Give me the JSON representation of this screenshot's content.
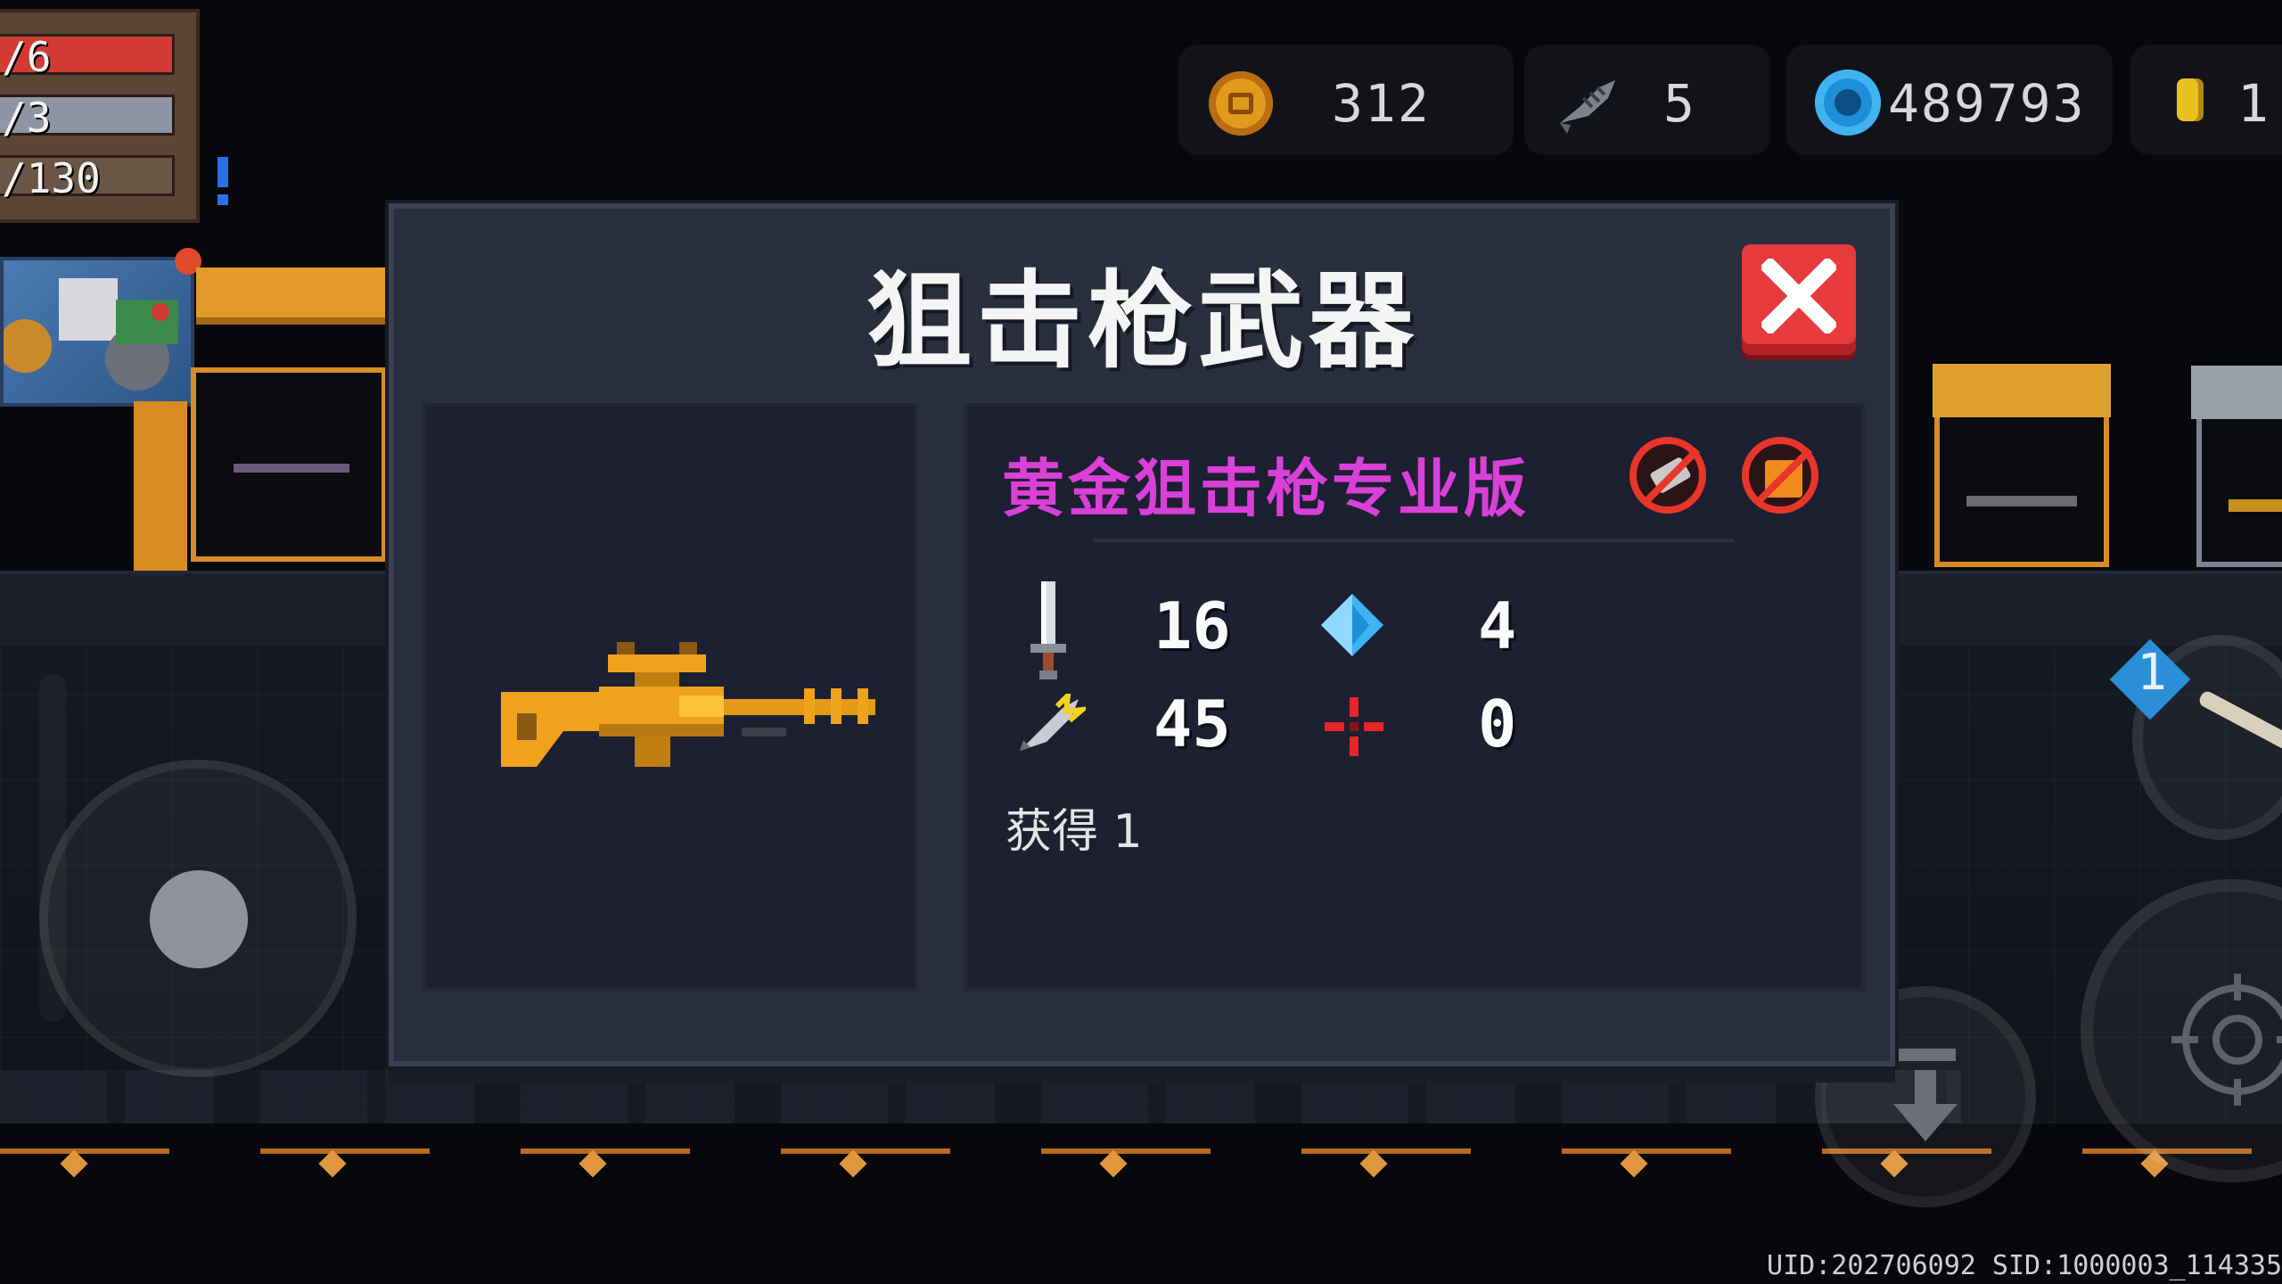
{
  "hud": {
    "hp_text": "/6",
    "armor_text": "/3",
    "energy_text": "/130"
  },
  "currency": {
    "coins": "312",
    "fish": "5",
    "gems": "489793",
    "tokens": "1"
  },
  "modal": {
    "title": "狙击枪武器",
    "weapon_name": "黄金狙击枪专业版",
    "stats": {
      "damage": "16",
      "energy_cost": "4",
      "crit": "45",
      "spread": "0"
    },
    "obtained_label": "获得 1"
  },
  "skill": {
    "badge": "1"
  },
  "footer": {
    "uid": "UID:202706092 SID:1000003_114335"
  },
  "colors": {
    "weapon_name": "#d940d8",
    "close_button": "#e63a3c",
    "gold": "#e0a030",
    "hp": "#d23a34"
  },
  "icons": {
    "currency": [
      "coin-icon",
      "fish-icon",
      "gem-icon",
      "token-icon"
    ],
    "stats": [
      "sword-icon",
      "diamond-icon",
      "crit-icon",
      "spread-icon"
    ],
    "restrictions": [
      "no-gun-icon",
      "no-box-icon"
    ]
  }
}
